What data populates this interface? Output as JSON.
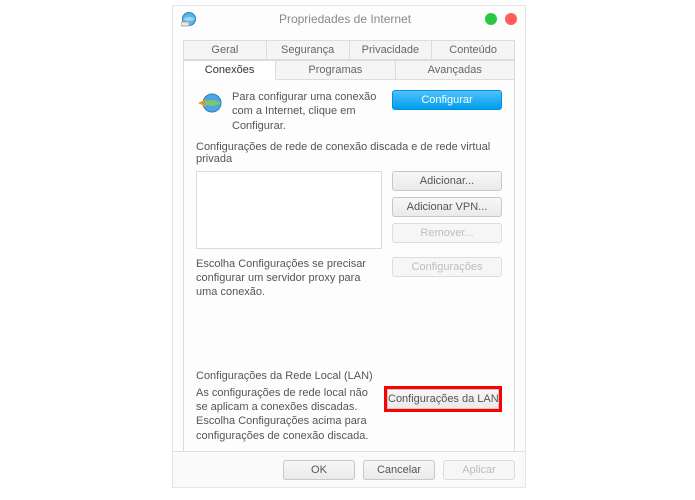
{
  "window": {
    "title": "Propriedades de Internet"
  },
  "tabs": {
    "row1": [
      "Geral",
      "Segurança",
      "Privacidade",
      "Conteúdo"
    ],
    "row2": [
      "Conexões",
      "Programas",
      "Avançadas"
    ],
    "active": "Conexões"
  },
  "intro": {
    "text": "Para configurar uma conexão com a Internet, clique em Configurar.",
    "button": "Configurar"
  },
  "dial": {
    "header": "Configurações de rede de conexão discada e de rede virtual privada",
    "buttons": {
      "add": "Adicionar...",
      "addVpn": "Adicionar VPN...",
      "remove": "Remover..."
    },
    "proxy_text": "Escolha Configurações se precisar configurar um servidor proxy para uma conexão.",
    "settings_btn": "Configurações"
  },
  "lan": {
    "header": "Configurações da Rede Local (LAN)",
    "text": "As configurações de rede local não se aplicam a conexões discadas. Escolha Configurações acima para configurações de conexão discada.",
    "button": "Configurações da LAN"
  },
  "footer": {
    "ok": "OK",
    "cancel": "Cancelar",
    "apply": "Aplicar"
  }
}
